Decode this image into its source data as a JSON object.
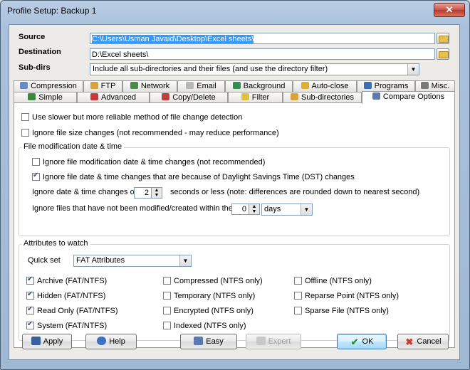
{
  "window": {
    "title": "Profile Setup: Backup 1",
    "close_glyph": "✕"
  },
  "fields": {
    "source_label": "Source",
    "source_value": "C:\\Users\\Usman Javaid\\Desktop\\Excel sheets\\",
    "destination_label": "Destination",
    "destination_value": "D:\\Excel sheets\\",
    "subdirs_label": "Sub-dirs",
    "subdirs_value": "Include all sub-directories and their files (and use the directory filter)"
  },
  "tabs_top": [
    "Compression",
    "FTP",
    "Network",
    "Email",
    "Background",
    "Auto-close",
    "Programs",
    "Misc."
  ],
  "tabs_bottom": [
    "Simple",
    "Advanced",
    "Copy/Delete",
    "Filter",
    "Sub-directories",
    "Compare Options"
  ],
  "options": {
    "slower_method": "Use slower but more reliable method of file change detection",
    "ignore_size": "Ignore file size changes (not recommended - may reduce performance)"
  },
  "date_group": {
    "title": "File modification date & time",
    "ignore_mod": "Ignore file modification date & time changes (not recommended)",
    "ignore_dst": "Ignore file date & time changes that are because of Daylight Savings Time (DST) changes",
    "ignore_changes_prefix": "Ignore date & time changes of",
    "ignore_changes_value": "2",
    "ignore_changes_suffix": "seconds or less (note: differences are rounded down to nearest second)",
    "not_modified_prefix": "Ignore files that have not been modified/created within the last",
    "not_modified_value": "0",
    "not_modified_unit": "days"
  },
  "attr_group": {
    "title": "Attributes to watch",
    "quickset_label": "Quick set",
    "quickset_value": "FAT Attributes",
    "col1": [
      "Archive (FAT/NTFS)",
      "Hidden (FAT/NTFS)",
      "Read Only (FAT/NTFS)",
      "System (FAT/NTFS)"
    ],
    "col2": [
      "Compressed (NTFS only)",
      "Temporary (NTFS only)",
      "Encrypted (NTFS only)",
      "Indexed (NTFS only)"
    ],
    "col3": [
      "Offline (NTFS only)",
      "Reparse Point (NTFS only)",
      "Sparse File (NTFS only)"
    ]
  },
  "buttons": {
    "apply": "Apply",
    "help": "Help",
    "easy": "Easy",
    "expert": "Expert",
    "ok": "OK",
    "cancel": "Cancel"
  },
  "colors": {
    "title_bar": "#b9cde3",
    "ok_focus": "#3c7fb1",
    "cancel_x": "#d03a2a"
  }
}
